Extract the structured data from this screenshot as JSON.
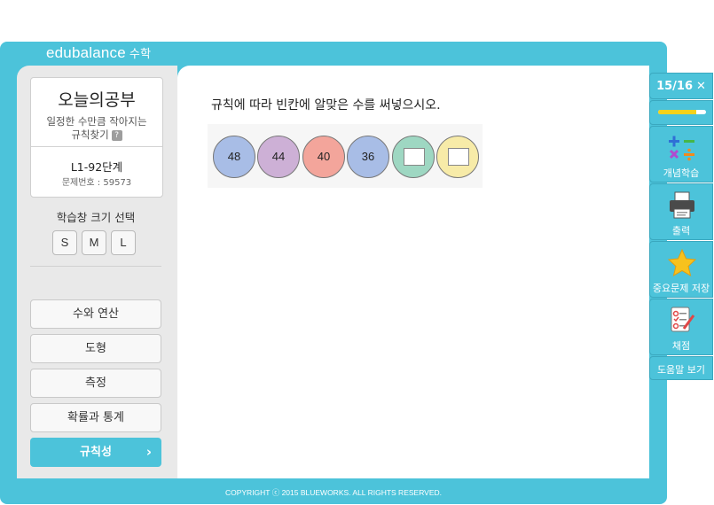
{
  "brand": {
    "logo": "edubalance",
    "logo_sub": "수학"
  },
  "today_card": {
    "title": "오늘의공부",
    "desc_line1": "일정한 수만큼 작아지는",
    "desc_line2": "규칙찾기",
    "help": "?",
    "level": "L1-92단계",
    "problem_no": "문제번호 : 59573"
  },
  "size_selector": {
    "label": "학습창 크기 선택",
    "options": [
      "S",
      "M",
      "L"
    ]
  },
  "categories": [
    {
      "label": "수와 연산",
      "active": false
    },
    {
      "label": "도형",
      "active": false
    },
    {
      "label": "측정",
      "active": false
    },
    {
      "label": "확률과 통계",
      "active": false
    },
    {
      "label": "규칙성",
      "active": true
    }
  ],
  "question": {
    "text": "규칙에 따라 빈칸에 알맞은 수를 써넣으시오.",
    "circles": [
      {
        "value": "48",
        "color": "#a8bde6"
      },
      {
        "value": "44",
        "color": "#cdb0d6"
      },
      {
        "value": "40",
        "color": "#f3a59b"
      },
      {
        "value": "36",
        "color": "#a8bde6"
      },
      {
        "value": "",
        "color": "#9ed7c2",
        "blank": true
      },
      {
        "value": "",
        "color": "#f7eba8",
        "blank": true
      }
    ]
  },
  "right_panel": {
    "counter": "15/16",
    "close": "✕",
    "progress": 0.8,
    "items": [
      {
        "label": "개념학습",
        "icon": "math-operators-icon"
      },
      {
        "label": "출력",
        "icon": "printer-icon"
      },
      {
        "label": "중요문제 저장",
        "icon": "star-icon"
      },
      {
        "label": "채점",
        "icon": "grading-icon"
      }
    ],
    "help_label": "도움말 보기"
  },
  "footer": "COPYRIGHT ⓒ 2015 BLUEWORKS. ALL RIGHTS RESERVED."
}
